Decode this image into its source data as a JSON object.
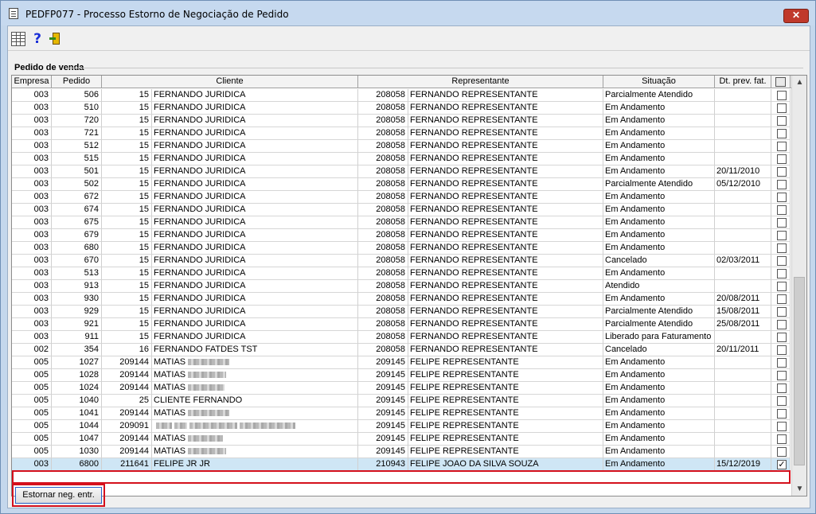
{
  "window": {
    "title": "PEDFP077 - Processo Estorno de Negociação de Pedido",
    "close_label": "✕"
  },
  "toolbar": {
    "grid_icon": "grid-icon",
    "help_label": "?",
    "exit_icon": "exit-door-icon"
  },
  "group": {
    "label": "Pedido de venda"
  },
  "grid": {
    "columns": [
      "Empresa",
      "Pedido",
      "Cliente",
      "Representante",
      "Situação",
      "Dt. prev. fat."
    ],
    "rows": [
      {
        "empresa": "003",
        "pedido": "506",
        "cli_cod": "15",
        "cli_nome": "FERNANDO  JURIDICA",
        "rep_cod": "208058",
        "rep_nome": "FERNANDO REPRESENTANTE",
        "situacao": "Parcialmente Atendido",
        "dt": "",
        "checked": ""
      },
      {
        "empresa": "003",
        "pedido": "510",
        "cli_cod": "15",
        "cli_nome": "FERNANDO  JURIDICA",
        "rep_cod": "208058",
        "rep_nome": "FERNANDO REPRESENTANTE",
        "situacao": "Em Andamento",
        "dt": "",
        "checked": ""
      },
      {
        "empresa": "003",
        "pedido": "720",
        "cli_cod": "15",
        "cli_nome": "FERNANDO  JURIDICA",
        "rep_cod": "208058",
        "rep_nome": "FERNANDO REPRESENTANTE",
        "situacao": "Em Andamento",
        "dt": "",
        "checked": ""
      },
      {
        "empresa": "003",
        "pedido": "721",
        "cli_cod": "15",
        "cli_nome": "FERNANDO  JURIDICA",
        "rep_cod": "208058",
        "rep_nome": "FERNANDO REPRESENTANTE",
        "situacao": "Em Andamento",
        "dt": "",
        "checked": ""
      },
      {
        "empresa": "003",
        "pedido": "512",
        "cli_cod": "15",
        "cli_nome": "FERNANDO  JURIDICA",
        "rep_cod": "208058",
        "rep_nome": "FERNANDO REPRESENTANTE",
        "situacao": "Em Andamento",
        "dt": "",
        "checked": ""
      },
      {
        "empresa": "003",
        "pedido": "515",
        "cli_cod": "15",
        "cli_nome": "FERNANDO  JURIDICA",
        "rep_cod": "208058",
        "rep_nome": "FERNANDO REPRESENTANTE",
        "situacao": "Em Andamento",
        "dt": "",
        "checked": ""
      },
      {
        "empresa": "003",
        "pedido": "501",
        "cli_cod": "15",
        "cli_nome": "FERNANDO  JURIDICA",
        "rep_cod": "208058",
        "rep_nome": "FERNANDO REPRESENTANTE",
        "situacao": "Em Andamento",
        "dt": "20/11/2010",
        "checked": ""
      },
      {
        "empresa": "003",
        "pedido": "502",
        "cli_cod": "15",
        "cli_nome": "FERNANDO  JURIDICA",
        "rep_cod": "208058",
        "rep_nome": "FERNANDO REPRESENTANTE",
        "situacao": "Parcialmente Atendido",
        "dt": "05/12/2010",
        "checked": ""
      },
      {
        "empresa": "003",
        "pedido": "672",
        "cli_cod": "15",
        "cli_nome": "FERNANDO  JURIDICA",
        "rep_cod": "208058",
        "rep_nome": "FERNANDO REPRESENTANTE",
        "situacao": "Em Andamento",
        "dt": "",
        "checked": ""
      },
      {
        "empresa": "003",
        "pedido": "674",
        "cli_cod": "15",
        "cli_nome": "FERNANDO  JURIDICA",
        "rep_cod": "208058",
        "rep_nome": "FERNANDO REPRESENTANTE",
        "situacao": "Em Andamento",
        "dt": "",
        "checked": ""
      },
      {
        "empresa": "003",
        "pedido": "675",
        "cli_cod": "15",
        "cli_nome": "FERNANDO  JURIDICA",
        "rep_cod": "208058",
        "rep_nome": "FERNANDO REPRESENTANTE",
        "situacao": "Em Andamento",
        "dt": "",
        "checked": ""
      },
      {
        "empresa": "003",
        "pedido": "679",
        "cli_cod": "15",
        "cli_nome": "FERNANDO  JURIDICA",
        "rep_cod": "208058",
        "rep_nome": "FERNANDO REPRESENTANTE",
        "situacao": "Em Andamento",
        "dt": "",
        "checked": ""
      },
      {
        "empresa": "003",
        "pedido": "680",
        "cli_cod": "15",
        "cli_nome": "FERNANDO  JURIDICA",
        "rep_cod": "208058",
        "rep_nome": "FERNANDO REPRESENTANTE",
        "situacao": "Em Andamento",
        "dt": "",
        "checked": ""
      },
      {
        "empresa": "003",
        "pedido": "670",
        "cli_cod": "15",
        "cli_nome": "FERNANDO  JURIDICA",
        "rep_cod": "208058",
        "rep_nome": "FERNANDO REPRESENTANTE",
        "situacao": "Cancelado",
        "dt": "02/03/2011",
        "checked": ""
      },
      {
        "empresa": "003",
        "pedido": "513",
        "cli_cod": "15",
        "cli_nome": "FERNANDO  JURIDICA",
        "rep_cod": "208058",
        "rep_nome": "FERNANDO REPRESENTANTE",
        "situacao": "Em Andamento",
        "dt": "",
        "checked": ""
      },
      {
        "empresa": "003",
        "pedido": "913",
        "cli_cod": "15",
        "cli_nome": "FERNANDO  JURIDICA",
        "rep_cod": "208058",
        "rep_nome": "FERNANDO REPRESENTANTE",
        "situacao": "Atendido",
        "dt": "",
        "checked": ""
      },
      {
        "empresa": "003",
        "pedido": "930",
        "cli_cod": "15",
        "cli_nome": "FERNANDO  JURIDICA",
        "rep_cod": "208058",
        "rep_nome": "FERNANDO REPRESENTANTE",
        "situacao": "Em Andamento",
        "dt": "20/08/2011",
        "checked": ""
      },
      {
        "empresa": "003",
        "pedido": "929",
        "cli_cod": "15",
        "cli_nome": "FERNANDO  JURIDICA",
        "rep_cod": "208058",
        "rep_nome": "FERNANDO REPRESENTANTE",
        "situacao": "Parcialmente Atendido",
        "dt": "15/08/2011",
        "checked": ""
      },
      {
        "empresa": "003",
        "pedido": "921",
        "cli_cod": "15",
        "cli_nome": "FERNANDO  JURIDICA",
        "rep_cod": "208058",
        "rep_nome": "FERNANDO REPRESENTANTE",
        "situacao": "Parcialmente Atendido",
        "dt": "25/08/2011",
        "checked": ""
      },
      {
        "empresa": "003",
        "pedido": "911",
        "cli_cod": "15",
        "cli_nome": "FERNANDO  JURIDICA",
        "rep_cod": "208058",
        "rep_nome": "FERNANDO REPRESENTANTE",
        "situacao": "Liberado para Faturamento",
        "dt": "",
        "checked": ""
      },
      {
        "empresa": "002",
        "pedido": "354",
        "cli_cod": "16",
        "cli_nome": "FERNANDO FATDES TST",
        "rep_cod": "208058",
        "rep_nome": "FERNANDO REPRESENTANTE",
        "situacao": "Cancelado",
        "dt": "20/11/2011",
        "checked": ""
      },
      {
        "empresa": "005",
        "pedido": "1027",
        "cli_cod": "209144",
        "cli_nome": "MATIAS",
        "rep_cod": "209145",
        "rep_nome": "FELIPE REPRESENTANTE",
        "situacao": "Em Andamento",
        "dt": "",
        "checked": ""
      },
      {
        "empresa": "005",
        "pedido": "1028",
        "cli_cod": "209144",
        "cli_nome": "MATIAS",
        "rep_cod": "209145",
        "rep_nome": "FELIPE REPRESENTANTE",
        "situacao": "Em Andamento",
        "dt": "",
        "checked": ""
      },
      {
        "empresa": "005",
        "pedido": "1024",
        "cli_cod": "209144",
        "cli_nome": "MATIAS",
        "rep_cod": "209145",
        "rep_nome": "FELIPE REPRESENTANTE",
        "situacao": "Em Andamento",
        "dt": "",
        "checked": ""
      },
      {
        "empresa": "005",
        "pedido": "1040",
        "cli_cod": "25",
        "cli_nome": "CLIENTE FERNANDO",
        "rep_cod": "209145",
        "rep_nome": "FELIPE REPRESENTANTE",
        "situacao": "Em Andamento",
        "dt": "",
        "checked": ""
      },
      {
        "empresa": "005",
        "pedido": "1041",
        "cli_cod": "209144",
        "cli_nome": "MATIAS",
        "rep_cod": "209145",
        "rep_nome": "FELIPE REPRESENTANTE",
        "situacao": "Em Andamento",
        "dt": "",
        "checked": ""
      },
      {
        "empresa": "005",
        "pedido": "1044",
        "cli_cod": "209091",
        "cli_nome": "",
        "rep_cod": "209145",
        "rep_nome": "FELIPE REPRESENTANTE",
        "situacao": "Em Andamento",
        "dt": "",
        "checked": ""
      },
      {
        "empresa": "005",
        "pedido": "1047",
        "cli_cod": "209144",
        "cli_nome": "MATIAS",
        "rep_cod": "209145",
        "rep_nome": "FELIPE REPRESENTANTE",
        "situacao": "Em Andamento",
        "dt": "",
        "checked": ""
      },
      {
        "empresa": "005",
        "pedido": "1030",
        "cli_cod": "209144",
        "cli_nome": "MATIAS",
        "rep_cod": "209145",
        "rep_nome": "FELIPE REPRESENTANTE",
        "situacao": "Em Andamento",
        "dt": "",
        "checked": ""
      },
      {
        "empresa": "003",
        "pedido": "6800",
        "cli_cod": "211641",
        "cli_nome": "FELIPE JR JR",
        "rep_cod": "210943",
        "rep_nome": "FELIPE JOAO DA SILVA SOUZA",
        "situacao": "Em Andamento",
        "dt": "15/12/2019",
        "checked": "✓"
      }
    ]
  },
  "actions": {
    "estornar_label": "Estornar neg. entr."
  },
  "colors": {
    "title_bar": "#c6d9ef",
    "close": "#c0392b",
    "highlight": "#d4101c",
    "selected_row": "#cfe6f5"
  }
}
